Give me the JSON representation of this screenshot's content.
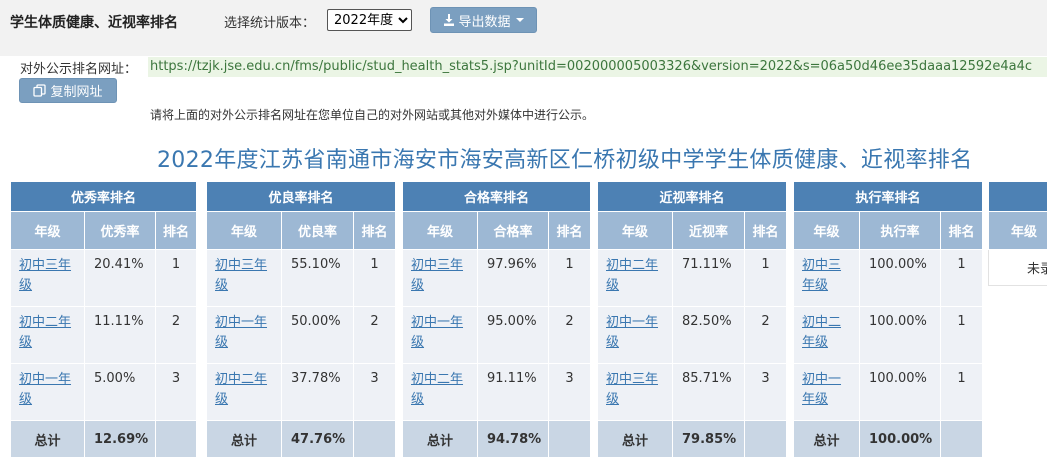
{
  "header": {
    "title": "学生体质健康、近视率排名",
    "version_label": "选择统计版本：",
    "version_selected": "2022年度",
    "export_label": "导出数据"
  },
  "share": {
    "url_label": "对外公示排名网址：",
    "url": "https://tzjk.jse.edu.cn/fms/public/stud_health_stats5.jsp?unitId=002000005003326&version=2022&s=06a50d46ee35daaa12592e4a4c",
    "copy_label": "复制网址",
    "hint": "请将上面的对外公示排名网址在您单位自己的对外网站或其他对外媒体中进行公示。"
  },
  "page_title": "2022年度江苏省南通市海安市海安高新区仁桥初级中学学生体质健康、近视率排名",
  "tables": [
    {
      "caption": "优秀率排名",
      "col_grade": "年级",
      "col_rate": "优秀率",
      "col_rank": "排名",
      "rows": [
        {
          "grade_a": "初中三年",
          "grade_b": "级",
          "rate": "20.41%",
          "rank": "1"
        },
        {
          "grade_a": "初中二年",
          "grade_b": "级",
          "rate": "11.11%",
          "rank": "2"
        },
        {
          "grade_a": "初中一年",
          "grade_b": "级",
          "rate": "5.00%",
          "rank": "3"
        }
      ],
      "total_label": "总计",
      "total_value": "12.69%"
    },
    {
      "caption": "优良率排名",
      "col_grade": "年级",
      "col_rate": "优良率",
      "col_rank": "排名",
      "rows": [
        {
          "grade_a": "初中三年",
          "grade_b": "级",
          "rate": "55.10%",
          "rank": "1"
        },
        {
          "grade_a": "初中一年",
          "grade_b": "级",
          "rate": "50.00%",
          "rank": "2"
        },
        {
          "grade_a": "初中二年",
          "grade_b": "级",
          "rate": "37.78%",
          "rank": "3"
        }
      ],
      "total_label": "总计",
      "total_value": "47.76%"
    },
    {
      "caption": "合格率排名",
      "col_grade": "年级",
      "col_rate": "合格率",
      "col_rank": "排名",
      "rows": [
        {
          "grade_a": "初中三年",
          "grade_b": "级",
          "rate": "97.96%",
          "rank": "1"
        },
        {
          "grade_a": "初中一年",
          "grade_b": "级",
          "rate": "95.00%",
          "rank": "2"
        },
        {
          "grade_a": "初中二年",
          "grade_b": "级",
          "rate": "91.11%",
          "rank": "3"
        }
      ],
      "total_label": "总计",
      "total_value": "94.78%"
    },
    {
      "caption": "近视率排名",
      "col_grade": "年级",
      "col_rate": "近视率",
      "col_rank": "排名",
      "rows": [
        {
          "grade_a": "初中二年",
          "grade_b": "级",
          "rate": "71.11%",
          "rank": "1"
        },
        {
          "grade_a": "初中一年",
          "grade_b": "级",
          "rate": "82.50%",
          "rank": "2"
        },
        {
          "grade_a": "初中三年",
          "grade_b": "级",
          "rate": "85.71%",
          "rank": "3"
        }
      ],
      "total_label": "总计",
      "total_value": "79.85%"
    },
    {
      "caption": "执行率排名",
      "col_grade": "年级",
      "col_rate": "执行率",
      "col_rank": "排名",
      "rows": [
        {
          "grade_a": "初中三",
          "grade_b": "年级",
          "rate": "100.00%",
          "rank": "1"
        },
        {
          "grade_a": "初中二",
          "grade_b": "年级",
          "rate": "100.00%",
          "rank": "1"
        },
        {
          "grade_a": "初中一",
          "grade_b": "年级",
          "rate": "100.00%",
          "rank": "1"
        }
      ],
      "total_label": "总计",
      "total_value": "100.00%"
    }
  ],
  "partial_table": {
    "col_grade": "年级",
    "cell_text": "未录"
  },
  "colors": {
    "caption_bg": "#4d81b4",
    "header_bg": "#9db8d4",
    "row_bg": "#eef1f6",
    "total_bg": "#c9d6e4",
    "link": "#3a77b0",
    "title": "#3a77b0",
    "url_bg": "#ebf5e5",
    "url_text": "#3c763d",
    "button_bg": "#7b9fc0"
  }
}
